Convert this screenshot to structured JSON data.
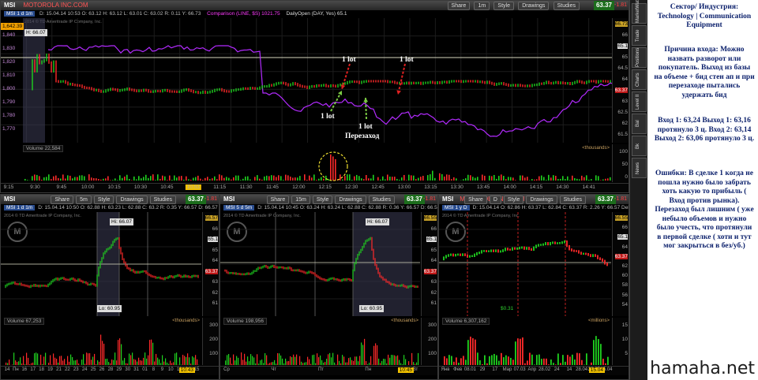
{
  "top_pane": {
    "title_symbol": "MSI",
    "title_text": "MOTOROLA INC.COM",
    "buttons": [
      "Share",
      "1m",
      "Style",
      "Drawings",
      "Studies"
    ],
    "price": "63.37",
    "change": "-1.81",
    "info": {
      "symbol": "MSI 1 d 1m",
      "text": "D: 15.04.14 10:53   O: 63.12   H: 63.12   L: 63.01   C: 63.02   R: 0.11   Y: 66.73",
      "comparison": "Comparison (LINE, $S)   1021.75",
      "daily_open": "DailyOpen (DAY, Yes)   65.1"
    },
    "copyright": "2014 © TD Ameritrade IP Company, Inc.",
    "left_price_tag": "1,642.39",
    "hi_tag": "H: 66.07",
    "left_axis_labels": [
      "1,840",
      "1,830",
      "1,820",
      "1,810",
      "1,800",
      "1,790",
      "1,780",
      "1,770"
    ],
    "right_axis_labels": [
      "66.73",
      "66",
      "65.1",
      "65",
      "64.5",
      "64",
      "63.37",
      "63",
      "62.5",
      "62",
      "61.5"
    ],
    "volume_label": "Volume   22,584",
    "volume_units": "<thousands>",
    "volume_axis": [
      "100",
      "50",
      "0"
    ],
    "time_labels": [
      "9:15",
      "9:30",
      "9:45",
      "10:00",
      "10:15",
      "10:30",
      "10:45",
      "10:53",
      "11:15",
      "11:30",
      "11:45",
      "12:00",
      "12:15",
      "12:30",
      "12:45",
      "13:00",
      "13:15",
      "13:30",
      "13:45",
      "14:00",
      "14:15",
      "14:30",
      "14:41"
    ],
    "highlight_time": "10:53",
    "annotations": {
      "lot1": "1 lot",
      "lot2": "1 lot",
      "lot3": "1 lot",
      "lot4": "1 lot",
      "reentry": "Перезаход"
    }
  },
  "bottom_left_pane": {
    "title_symbol": "MSI",
    "buttons": [
      "Share",
      "5m",
      "Style",
      "Drawings",
      "Studies"
    ],
    "price": "63.37",
    "change": "-1.81",
    "info_symbol": "MSI 1 d 1m",
    "info": "D: 15.04.14 10:50   O: 62.88   H: 63.23   L: 62.88   C: 63.2   R: 0.35   Y: 66.57   D: 66.57",
    "copyright": "2014 © TD Ameritrade IP Company, Inc.",
    "hi_tag": "Hi: 66.07",
    "lo_tag": "Lo: 60.95",
    "right_axis_labels": [
      "66.57",
      "66",
      "65.1",
      "65",
      "64",
      "63.37",
      "63",
      "62",
      "61"
    ],
    "volume_label": "Volume   67,253",
    "volume_units": "<thousands>",
    "volume_axis": [
      "300",
      "200",
      "100"
    ],
    "time_labels": [
      "14",
      "Пн",
      "16",
      "17",
      "18",
      "19",
      "21",
      "22",
      "23",
      "24",
      "25",
      "26",
      "28",
      "29",
      "30",
      "31",
      "01",
      "8",
      "9",
      "10",
      "11",
      "14",
      "15"
    ],
    "highlight_time": "10:43"
  },
  "bottom_mid_pane": {
    "title_symbol": "MSI",
    "buttons": [
      "Share",
      "15m",
      "Style",
      "Drawings",
      "Studies"
    ],
    "price": "63.37",
    "change": "-1.81",
    "info_symbol": "MSI 5 d 5m",
    "info": "D: 15.04.14 10:45   O: 63.24   H: 63.24   L: 62.88   C: 62.88   R: 0.36   Y: 66.57   D: 66.57",
    "copyright": "2014 © TD Ameritrade IP Company, Inc.",
    "hi_tag": "Hi: 66.07",
    "lo_tag": "Lo: 60.95",
    "right_axis_labels": [
      "66.55",
      "66",
      "65.1",
      "65",
      "64",
      "63.37",
      "63",
      "62",
      "61"
    ],
    "volume_label": "Volume   198,956",
    "volume_units": "<thousands>",
    "volume_axis": [
      "300",
      "200",
      "100"
    ],
    "time_labels": [
      "Ср",
      "Чт",
      "Пт",
      "Пн",
      "Вт"
    ],
    "highlight_time": "10:45"
  },
  "bottom_right_pane": {
    "title_symbol": "MSI",
    "title_text": "MOTOROLA INC.COM",
    "buttons": [
      "Share",
      "D",
      "Style",
      "Drawings",
      "Studies"
    ],
    "price": "63.37",
    "change": "-1.81",
    "info_symbol": "MSI 1 y D",
    "info": "D: 15.04.14   O: 62.86   H: 63.37   L: 62.84   C: 63.37   R: 2.26   Y: 66.57   Del...",
    "copyright": "2014 © TD Ameritrade IP Company, Inc.",
    "right_axis_labels": [
      "66.55",
      "66",
      "65.1",
      "64",
      "63.37",
      "62",
      "60",
      "58",
      "56",
      "54"
    ],
    "div_tag": "$0.31",
    "volume_label": "Volume   6,307,162",
    "volume_units": "<millions>",
    "volume_axis": [
      "15",
      "10",
      "5"
    ],
    "time_labels": [
      "Янв",
      "Фев",
      "08.01",
      "29",
      "17",
      "Мар",
      "07.03",
      "Апр",
      "28.02",
      "24",
      "14",
      "28.04",
      "26.05",
      "15.04"
    ],
    "highlight_time": "15.04"
  },
  "side_tabs": [
    "MarketWatch",
    "Trade",
    "Positions",
    "Charts",
    "Level II",
    "Bal",
    "Bk",
    "News"
  ],
  "notes": {
    "sector": "Сектор/ Индустрия: Technology | Communication Equipment",
    "reason": "Причина входа: Можно назвать разворот или покупатель. Выход из базы на объеме + бид стен ап и при перезаходе пытались удержать бид",
    "trades": "Вход 1: 63,24 Выход 1: 63,16 протянуло 3 ц. Вход 2: 63,14 Выход 2: 63,06 протянуло 3 ц.",
    "errors": "Ошибки: В сделке 1 когда не пошла нужно было забрать хоть какую то прибыль ( Вход против рынка). Перезаход был лишним ( уже небыло объемов и нужно было учесть, что протянули в первой сделке ( хоти и тут мог закрыться в без/уб.)"
  },
  "watermark": "hamaha.net",
  "colors": {
    "candle_up": "#1fd11f",
    "candle_down": "#ff2a2a",
    "comparison_line": "#b32bff",
    "daily_open_line": "#d8d8c0",
    "annotation_arrow_green": "#7ac943",
    "annotation_arrow_red": "#e02020",
    "note_text": "#0a1f6b"
  }
}
